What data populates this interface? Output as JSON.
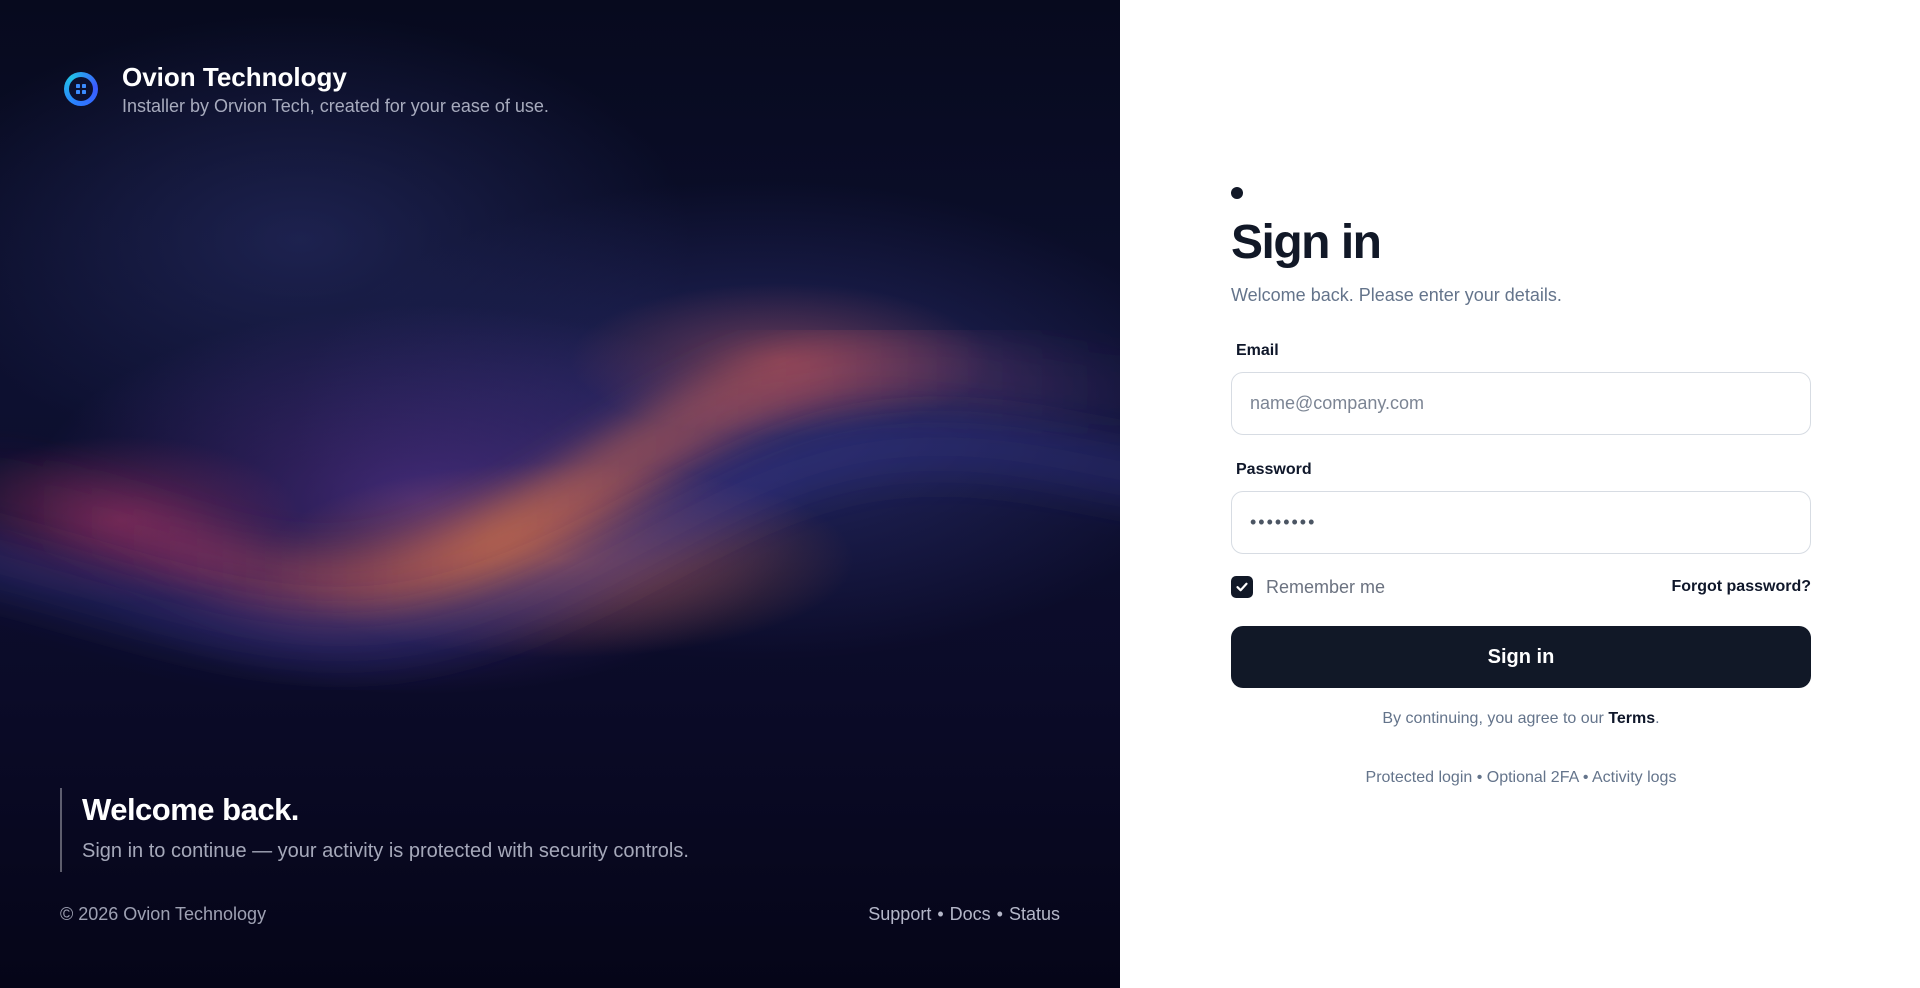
{
  "brand": {
    "title": "Ovion Technology",
    "subtitle": "Installer by Orvion Tech, created for your ease of use.",
    "logo_icon": "grid-logo-icon"
  },
  "hero": {
    "welcome_title": "Welcome back.",
    "welcome_text": "Sign in to continue — your activity is protected with security controls.",
    "copyright": "© 2026 Ovion Technology",
    "links": [
      "Support",
      "Docs",
      "Status"
    ],
    "link_separator": "•"
  },
  "form": {
    "title": "Sign in",
    "subtitle": "Welcome back. Please enter your details.",
    "email_label": "Email",
    "email_placeholder": "name@company.com",
    "email_value": "",
    "password_label": "Password",
    "password_value": "••••••••",
    "remember_label": "Remember me",
    "remember_checked": true,
    "forgot_label": "Forgot password?",
    "submit_label": "Sign in",
    "terms_prefix": "By continuing, you agree to our ",
    "terms_link": "Terms",
    "terms_suffix": ".",
    "features": "Protected login • Optional 2FA • Activity logs"
  },
  "colors": {
    "primary": "#111827",
    "muted_text": "#64748b",
    "input_border": "#d7dce3",
    "logo_gradient_start": "#2b7fff",
    "logo_gradient_end": "#22c0e8"
  }
}
